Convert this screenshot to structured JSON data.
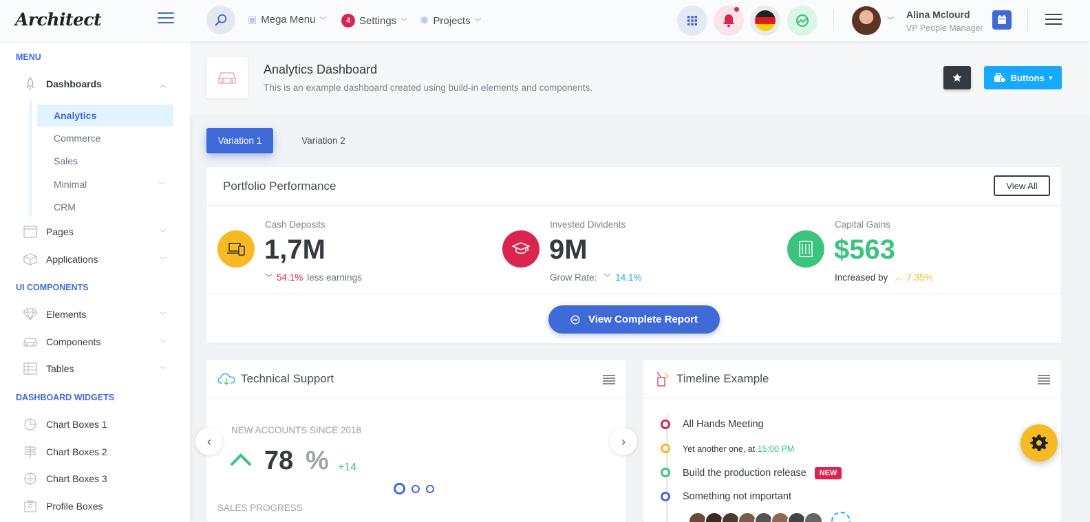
{
  "header": {
    "logo": "Architect",
    "nav": {
      "mega_menu": "Mega Menu",
      "settings": "Settings",
      "settings_badge": "4",
      "projects": "Projects"
    },
    "user": {
      "name": "Alina Mclourd",
      "role": "VP People Manager"
    }
  },
  "sidebar": {
    "menu_heading": "Menu",
    "dashboards": "Dashboards",
    "dashboard_subs": [
      "Analytics",
      "Commerce",
      "Sales",
      "Minimal",
      "CRM"
    ],
    "pages": "Pages",
    "applications": "Applications",
    "ui_heading": "UI Components",
    "elements": "Elements",
    "components": "Components",
    "tables": "Tables",
    "widgets_heading": "Dashboard Widgets",
    "chart_boxes_1": "Chart Boxes 1",
    "chart_boxes_2": "Chart Boxes 2",
    "chart_boxes_3": "Chart Boxes 3",
    "profile_boxes": "Profile Boxes"
  },
  "page": {
    "title": "Analytics Dashboard",
    "subtitle": "This is an example dashboard created using build-in elements and components.",
    "buttons_label": "Buttons"
  },
  "tabs": [
    "Variation 1",
    "Variation 2"
  ],
  "portfolio": {
    "title": "Portfolio Performance",
    "view_all": "View All",
    "stats": [
      {
        "label": "Cash Deposits",
        "value": "1,7M",
        "pct": "54.1%",
        "note": "less earnings"
      },
      {
        "label": "Invested Dividents",
        "value": "9M",
        "prefix": "Grow Rate:",
        "pct": "14.1%"
      },
      {
        "label": "Capital Gains",
        "value": "$563",
        "prefix": "Increased by",
        "pct": "7.35%"
      }
    ],
    "report_button": "View Complete Report"
  },
  "support": {
    "title": "Technical Support",
    "accounts_label": "New accounts since 2018",
    "value": "78",
    "unit": "%",
    "delta": "+14",
    "sales_label": "Sales Progress"
  },
  "timeline": {
    "title": "Timeline Example",
    "items": [
      {
        "text": "All Hands Meeting"
      },
      {
        "text": "Yet another one, at",
        "time": "15:00 PM"
      },
      {
        "text": "Build the production release",
        "badge": "NEW"
      },
      {
        "text": "Something not important"
      }
    ]
  },
  "colors": {
    "primary": "#3f6ad8",
    "danger": "#d92550",
    "warning": "#f7b924",
    "success": "#3ac47d",
    "info": "#16aaff",
    "dark": "#343a40"
  }
}
